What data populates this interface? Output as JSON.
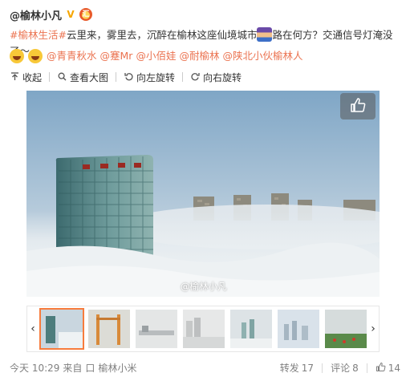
{
  "header": {
    "username": "@榆林小凡",
    "verified_badge": "V",
    "medal_badge": "汇"
  },
  "post": {
    "topic": "#榆林生活#",
    "text_before_emoji": "云里来，雾里去，沉醉在榆林这座仙境城市",
    "text_after_emoji": "路在何方？交通信号灯淹没了～",
    "mentions": [
      "@青青秋水",
      "@蹇Mr",
      "@小佰娃",
      "@耐榆林",
      "@陕北小伙榆林人"
    ]
  },
  "toolbar": {
    "collapse_label": "收起",
    "view_large_label": "查看大图",
    "rotate_left_label": "向左旋转",
    "rotate_right_label": "向右旋转",
    "icons": [
      "collapse-icon",
      "search-icon",
      "rotate-left-icon",
      "rotate-right-icon"
    ]
  },
  "photo": {
    "watermark": "@榆林小凡"
  },
  "thumbnails": {
    "count": 7,
    "active_index": 0,
    "prev_arrow": "‹",
    "next_arrow": "›"
  },
  "footer": {
    "time": "今天 10:29",
    "source_prefix": "来自",
    "source_icon": "口",
    "source_name": "榆林小米",
    "repost_label": "转发",
    "repost_count": "17",
    "comment_label": "评论",
    "comment_count": "8",
    "like_count": "14"
  },
  "colors": {
    "link": "#eb7350",
    "text": "#333333",
    "muted": "#808080",
    "active_thumb_border": "#f77c3d"
  }
}
